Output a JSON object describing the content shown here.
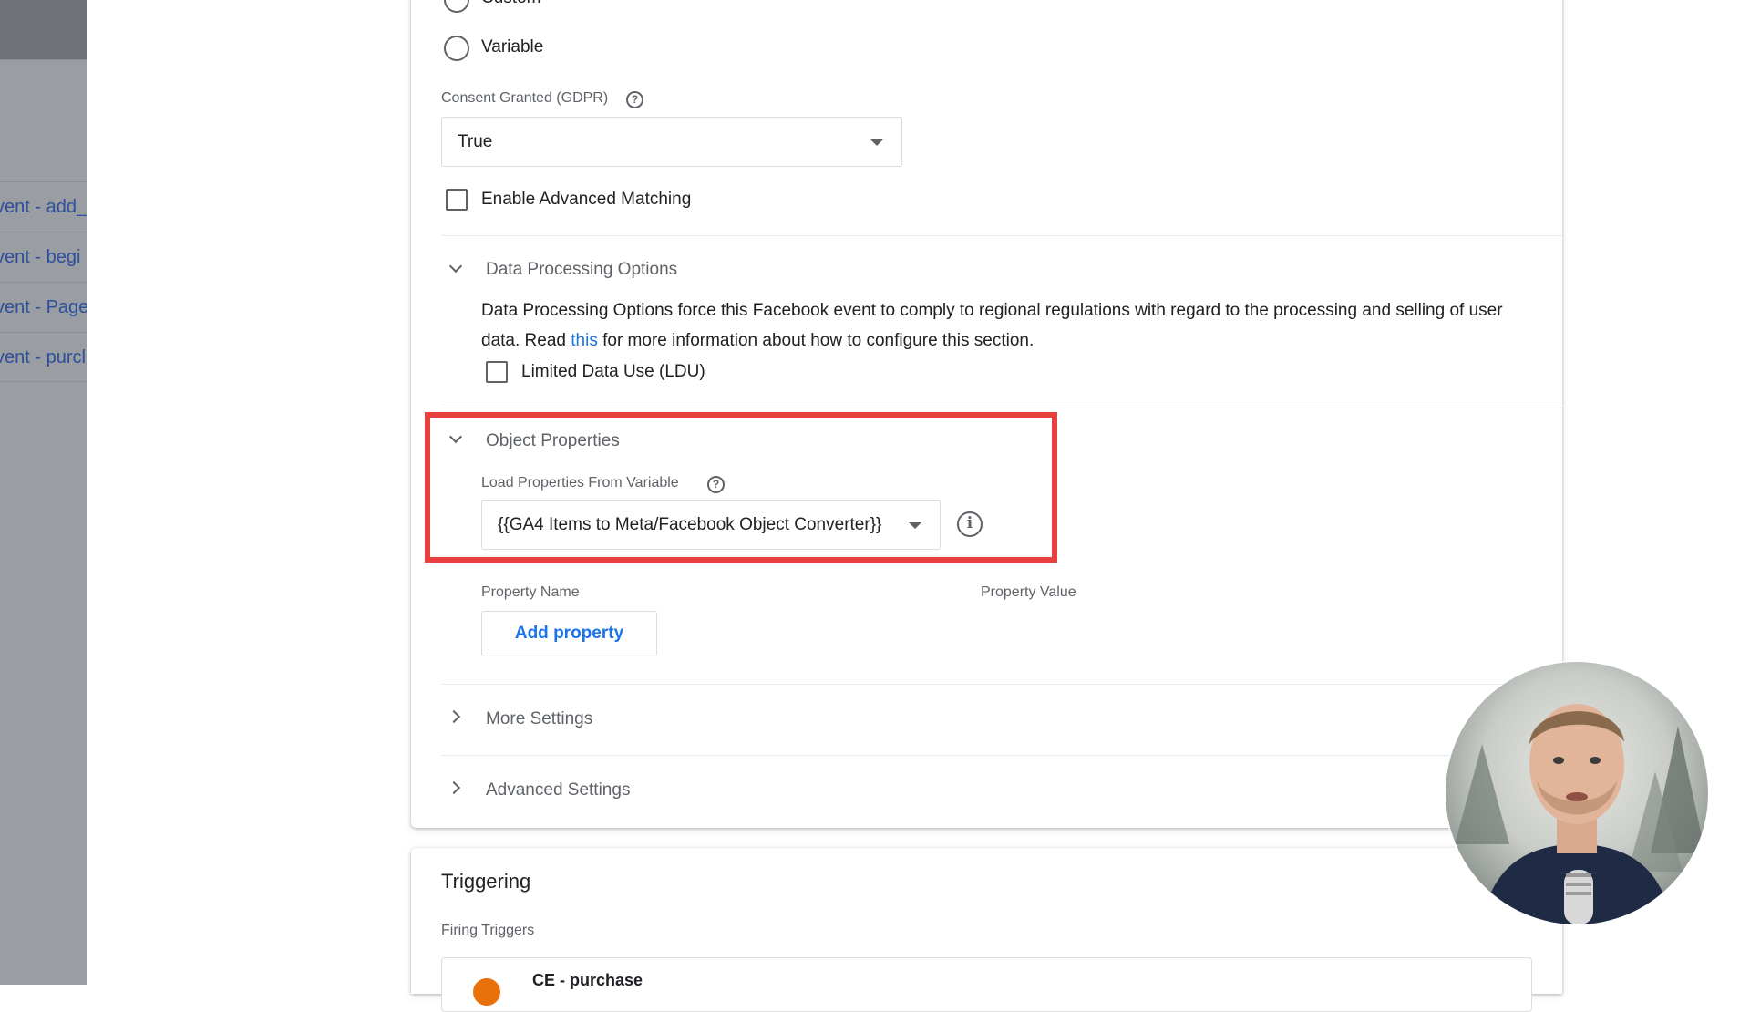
{
  "sidebar": {
    "items": [
      {
        "label": "vent - add_"
      },
      {
        "label": "vent - begi"
      },
      {
        "label": "vent - Page"
      },
      {
        "label": "vent - purcl"
      }
    ]
  },
  "tag_config": {
    "radio_custom_label": "Custom",
    "radio_variable_label": "Variable",
    "consent_label": "Consent Granted (GDPR)",
    "consent_value": "True",
    "advanced_matching_label": "Enable Advanced Matching",
    "data_processing": {
      "title": "Data Processing Options",
      "description_pre": "Data Processing Options force this Facebook event to comply to regional regulations with regard to the processing and selling of user data. Read ",
      "link_text": "this",
      "description_post": " for more information about how to configure this section.",
      "ldu_label": "Limited Data Use (LDU)"
    },
    "object_properties": {
      "title": "Object Properties",
      "load_label": "Load Properties From Variable",
      "load_value": "{{GA4 Items to Meta/Facebook Object Converter}}",
      "col_name": "Property Name",
      "col_value": "Property Value",
      "add_button": "Add property"
    },
    "more_settings": "More Settings",
    "advanced_settings": "Advanced Settings"
  },
  "triggering": {
    "title": "Triggering",
    "firing_label": "Firing Triggers",
    "trigger_name": "CE - purchase"
  },
  "colors": {
    "highlight": "#e8403f",
    "link": "#1a73e8",
    "trigger_dot": "#e8710a"
  }
}
